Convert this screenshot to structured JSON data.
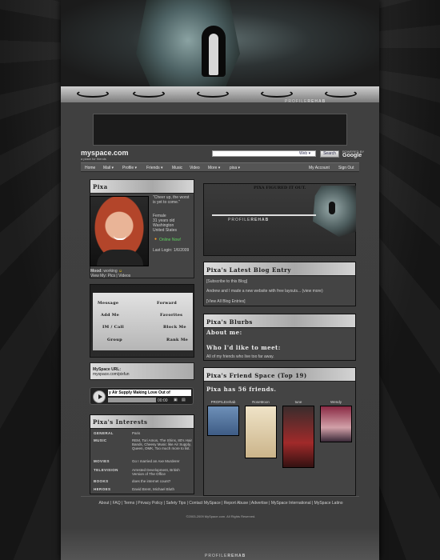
{
  "branding": {
    "profile_rehab": "PROFILE",
    "profile_rehab_bold": "REHAB",
    "myspace_logo": "myspace.com",
    "myspace_tag": "a place for friends"
  },
  "search": {
    "select_value": "Web ▾",
    "button_label": "Search",
    "powered_by": "POWERED BY",
    "google": "Google"
  },
  "nav": {
    "items": [
      "Home",
      "Mail ▾",
      "Profile ▾",
      "Friends ▾",
      "Music",
      "Video",
      "More ▾",
      "pixa ▾"
    ],
    "my_account": "My Account",
    "sign_out": "Sign Out"
  },
  "profile": {
    "name": "Pixa",
    "quote": "\"Cheer up, the worst is yet to come.\"",
    "gender": "Female",
    "age": "31 years old",
    "city": "Washington",
    "country": "United States",
    "online": "Online Now!",
    "last_login": "Last Login: 1/6/2009",
    "mood_label": "Mood:",
    "mood": "working",
    "view_links": "View My: Pics | Videos"
  },
  "contact": {
    "message": "Message",
    "forward": "Forward",
    "add_me": "Add Me",
    "favorites": "Favorites",
    "im_call": "IM / Call",
    "block_me": "Block Me",
    "group": "Group",
    "rank_me": "Rank Me"
  },
  "url": {
    "label": "MySpace URL:",
    "value": "myspace.com/pixfun"
  },
  "player": {
    "title": "y Air Supply Making Love Out of",
    "time": "00:00"
  },
  "interests": {
    "title": "Pixa's Interests",
    "rows": [
      {
        "label": "GENERAL",
        "value": "Paris"
      },
      {
        "label": "MUSIC",
        "value": "REM, Tori Amos, The Shins, 80's Hair Bands, Cheesy Music like Air Supply, Queen, OMK, Too much more to list."
      },
      {
        "label": "MOVIES",
        "value": "Go I married an Axe Murderer"
      },
      {
        "label": "TELEVISION",
        "value": "Arrested Development, British Version of The Office"
      },
      {
        "label": "BOOKS",
        "value": "does the internet count?"
      },
      {
        "label": "HEROES",
        "value": "David Brent, Michael Bluth"
      }
    ]
  },
  "banner": {
    "text": "PIXA FIGURED IT OUT."
  },
  "blog": {
    "title": "Pixa's Latest Blog Entry",
    "subscribe": "[Subscribe to this Blog]",
    "entry": "Andrew and I made a new website with free layouts... (view more)",
    "view_all": "[View All Blog Entries]"
  },
  "blurbs": {
    "title": "Pixa's Blurbs",
    "about_me": "About me:",
    "like_to_meet": "Who I'd like to meet:",
    "like_to_meet_text": "All of my friends who live too far away."
  },
  "friends": {
    "title": "Pixa's Friend Space (Top 19)",
    "count_text": "Pixa has 56 friends.",
    "list": [
      {
        "name": "PROFILErehab"
      },
      {
        "name": "RoseMoon"
      },
      {
        "name": "tune"
      },
      {
        "name": "Wendy"
      }
    ]
  },
  "footer": {
    "links": "About | FAQ | Terms | Privacy Policy | Safety Tips | Contact MySpace | Report Abuse | Advertise | MySpace International | MySpace Latino",
    "copyright": "©2003-2009 MySpace.com. All Rights Reserved."
  }
}
